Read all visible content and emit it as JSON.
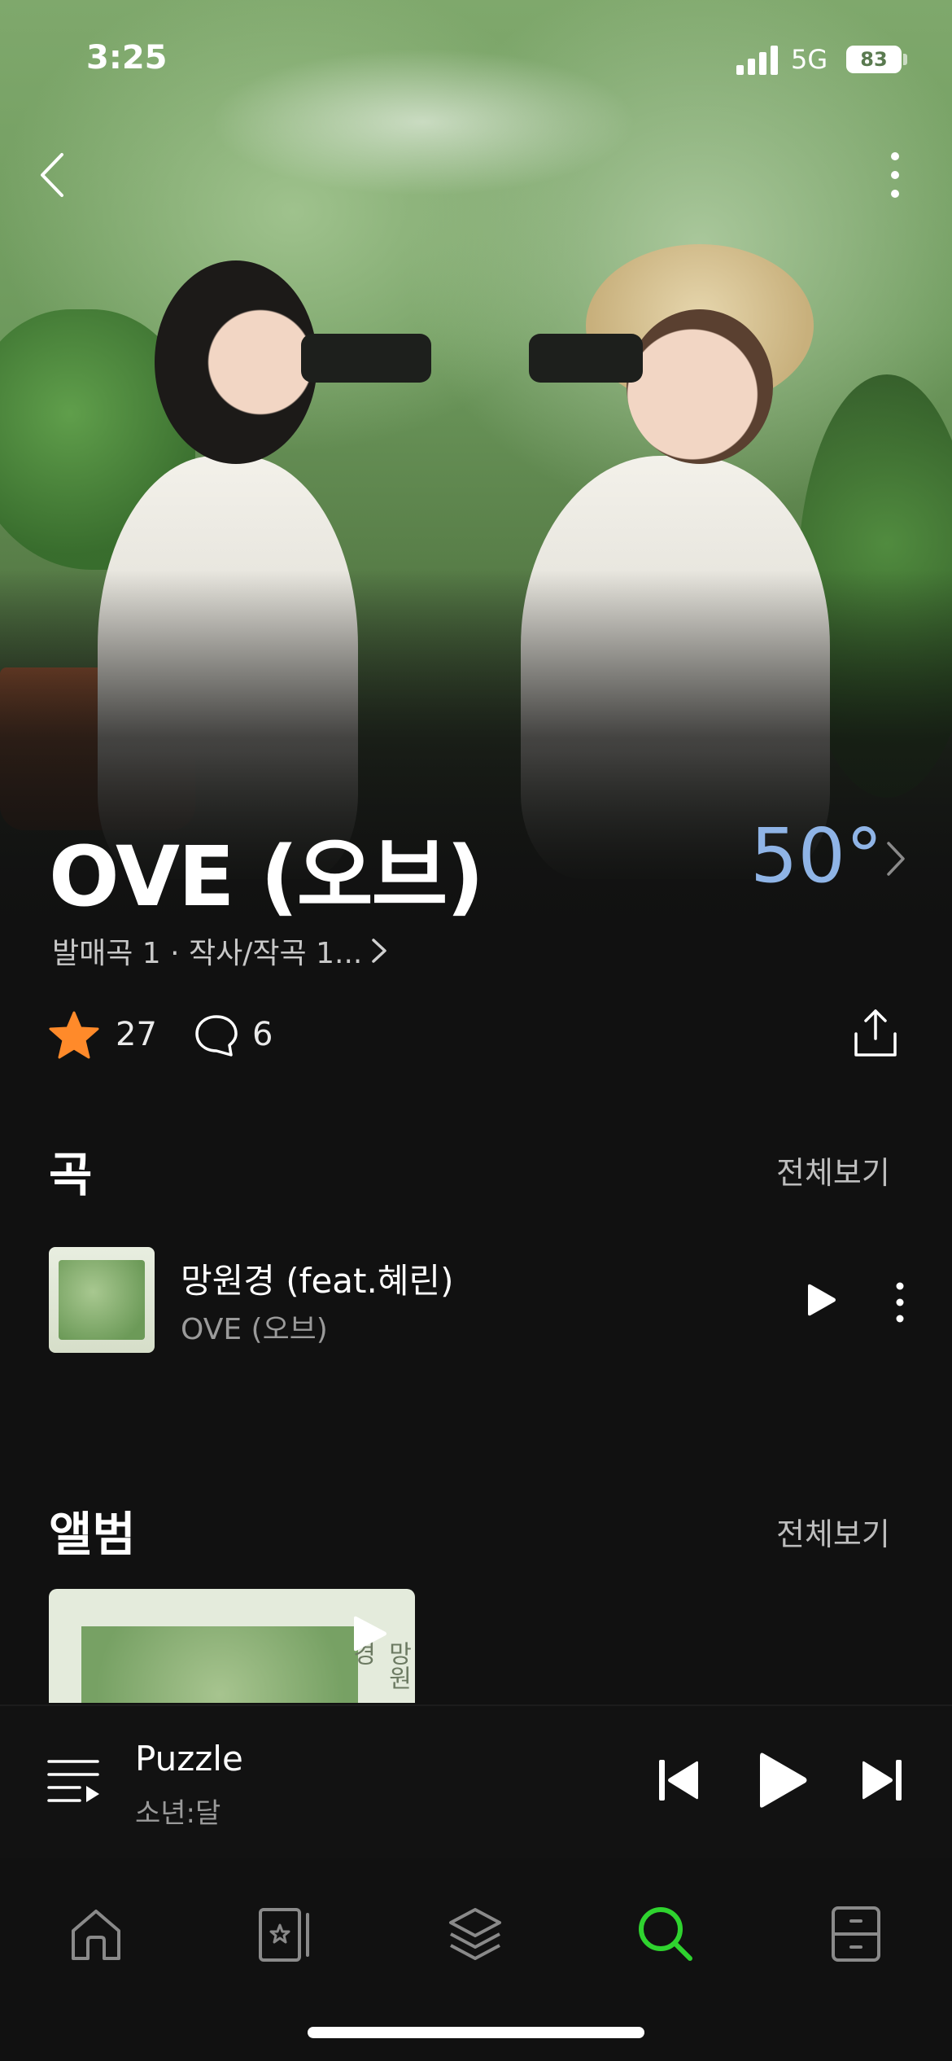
{
  "status_bar": {
    "time": "3:25",
    "network": "5G",
    "battery": "83"
  },
  "header": {
    "back_icon": "chevron-left-icon",
    "more_icon": "vertical-dots-icon"
  },
  "artist": {
    "name": "OVE (오브)",
    "degree": "50°",
    "meta": "발매곡 1 · 작사/작곡 1...",
    "likes": "27",
    "comments": "6"
  },
  "songs_section": {
    "title": "곡",
    "see_all": "전체보기",
    "items": [
      {
        "title": "망원경 (feat.혜린)",
        "artist": "OVE (오브)"
      }
    ]
  },
  "albums_section": {
    "title": "앨범",
    "see_all": "전체보기",
    "cover_text": "망원경"
  },
  "mini_player": {
    "title": "Puzzle",
    "artist": "소년:달"
  },
  "tabbar": {
    "items": [
      {
        "icon": "home-icon",
        "active": false
      },
      {
        "icon": "library-star-icon",
        "active": false
      },
      {
        "icon": "layers-icon",
        "active": false
      },
      {
        "icon": "search-icon",
        "active": true
      },
      {
        "icon": "locker-icon",
        "active": false
      }
    ]
  },
  "colors": {
    "accent_green": "#2fd32f",
    "degree_blue": "#8fb4e6",
    "star_orange": "#ff8a2a",
    "background": "#111111"
  }
}
